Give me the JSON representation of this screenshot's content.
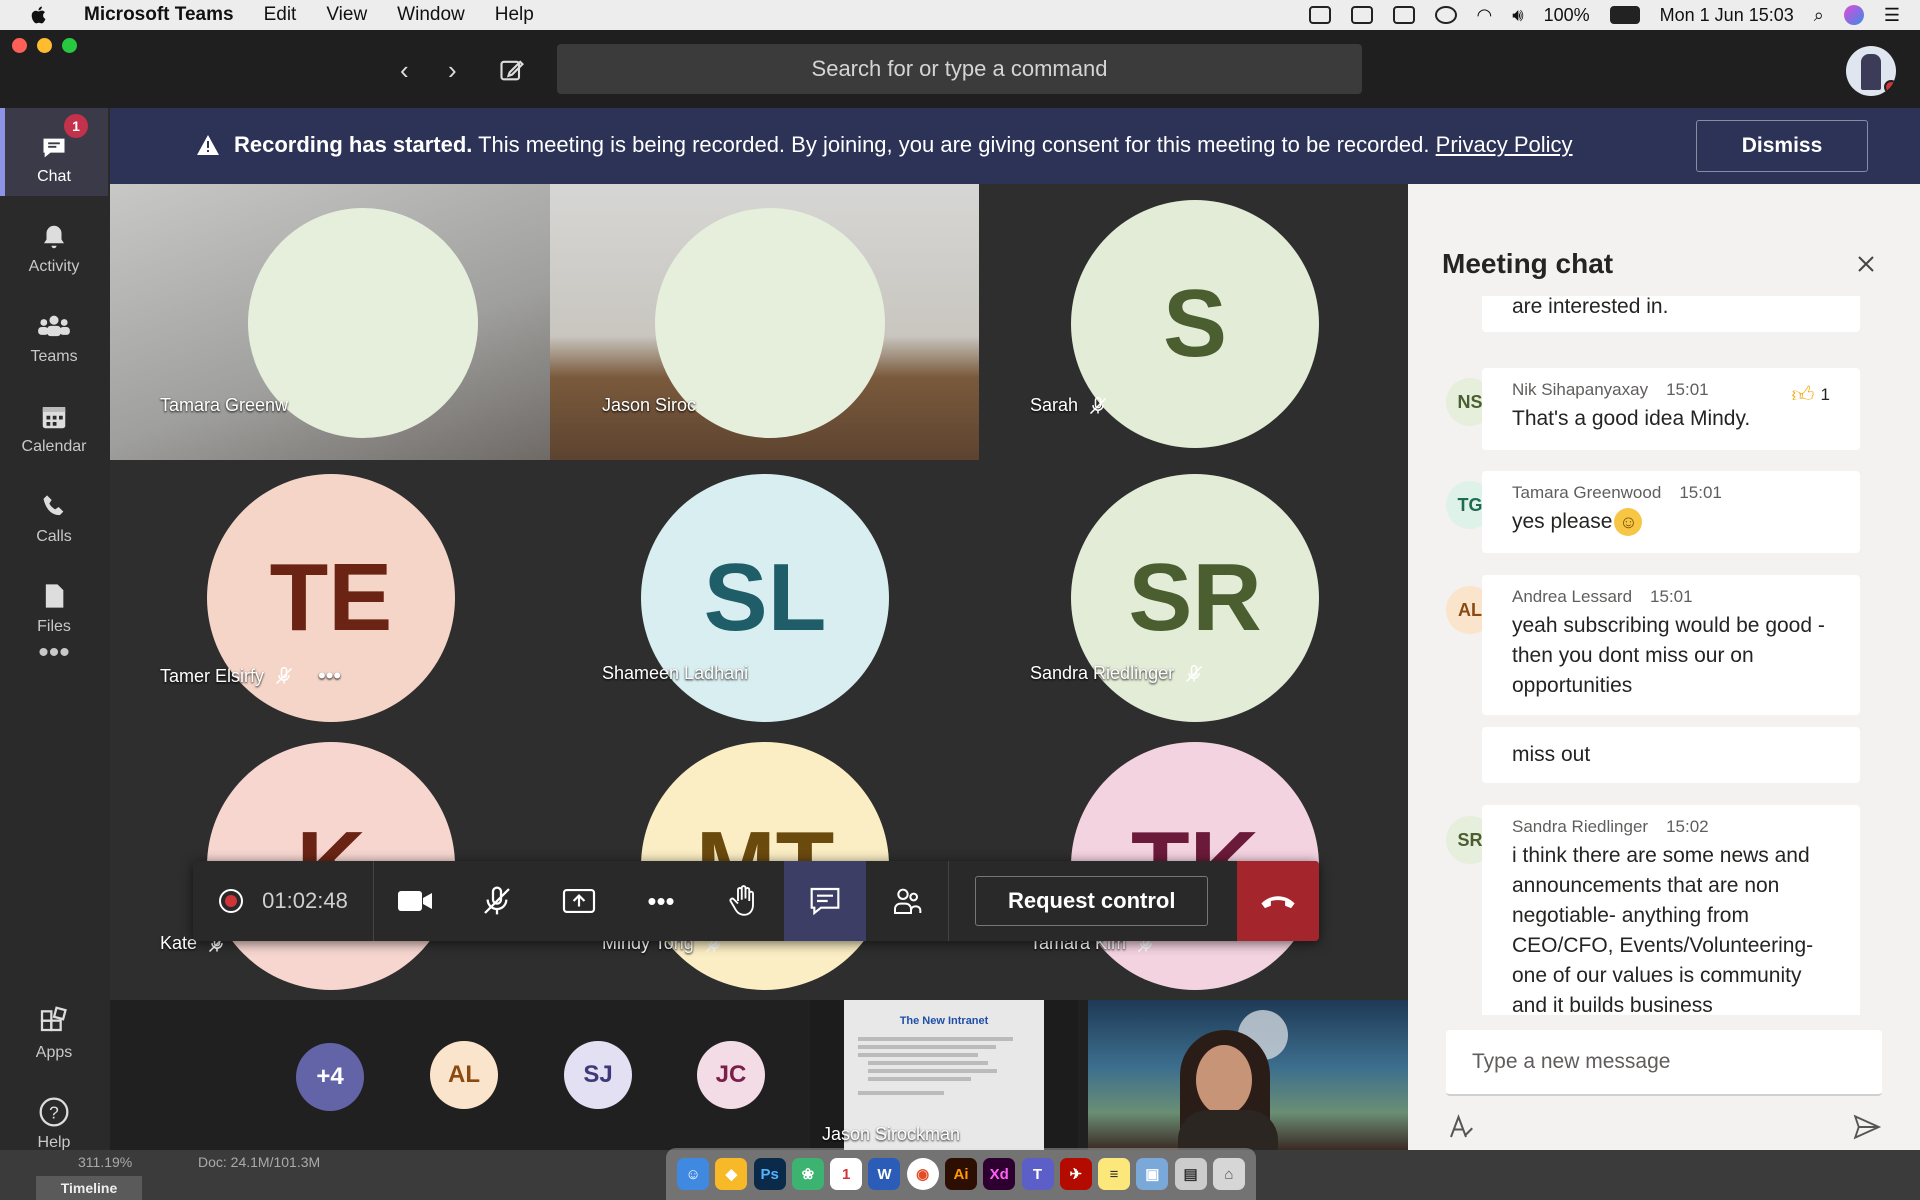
{
  "menubar": {
    "items": [
      "Microsoft Teams",
      "Edit",
      "View",
      "Window",
      "Help"
    ],
    "battery": "100%",
    "datetime": "Mon 1 Jun  15:03"
  },
  "titlebar": {
    "search_placeholder": "Search for or type a command"
  },
  "rail": {
    "items": [
      {
        "label": "Chat",
        "badge": "1",
        "icon": "chat-icon"
      },
      {
        "label": "Activity",
        "icon": "bell-icon"
      },
      {
        "label": "Teams",
        "icon": "teams-icon"
      },
      {
        "label": "Calendar",
        "icon": "calendar-icon"
      },
      {
        "label": "Calls",
        "icon": "phone-icon"
      },
      {
        "label": "Files",
        "icon": "file-icon"
      },
      {
        "label": "Apps",
        "icon": "apps-icon"
      },
      {
        "label": "Help",
        "icon": "help-icon"
      }
    ]
  },
  "banner": {
    "bold": "Recording has started.",
    "text": " This meeting is being recorded. By joining, you are giving consent for this meeting to be recorded. ",
    "link": "Privacy Policy",
    "dismiss": "Dismiss"
  },
  "participants": [
    {
      "name": "Tamara Greenw",
      "initials": "",
      "muted": false
    },
    {
      "name": "Jason Siroc",
      "initials": "",
      "muted": false
    },
    {
      "name": "Sarah",
      "initials": "S",
      "muted": true
    },
    {
      "name": "Tamer Elsirfy",
      "initials": "TE",
      "muted": true
    },
    {
      "name": "Shameen Ladhani",
      "initials": "SL",
      "muted": false
    },
    {
      "name": "Sandra Riedlinger",
      "initials": "SR",
      "muted": true
    },
    {
      "name": "Kate",
      "initials": "K",
      "muted": true
    },
    {
      "name": "Mindy Tong",
      "initials": "MT",
      "muted": true
    },
    {
      "name": "Tamara Kim",
      "initials": "TK",
      "muted": true
    }
  ],
  "overflow": [
    "+4",
    "AL",
    "SJ",
    "JC"
  ],
  "share_tile": {
    "slide_title": "The New Intranet",
    "presenter": "Jason Sirockman"
  },
  "controls": {
    "timer": "01:02:48",
    "request_control": "Request control"
  },
  "chat": {
    "title": "Meeting chat",
    "messages": [
      {
        "initials": "",
        "author": "",
        "time": "",
        "text": "are interested in."
      },
      {
        "initials": "NS",
        "author": "Nik Sihapanyaxay",
        "time": "15:01",
        "text": "That's a good idea Mindy.",
        "reaction_count": "1"
      },
      {
        "initials": "TG",
        "author": "Tamara Greenwood",
        "time": "15:01",
        "text": "yes please"
      },
      {
        "initials": "AL",
        "author": "Andrea Lessard",
        "time": "15:01",
        "text": "yeah subscribing would be good - then you dont miss our on opportunities"
      },
      {
        "initials": "",
        "author": "",
        "time": "",
        "text": "miss out"
      },
      {
        "initials": "SR",
        "author": "Sandra Riedlinger",
        "time": "15:02",
        "text": "i think there are some news and announcements that are non negotiable- anything from CEO/CFO, Events/Volunteering- one of our values is community and it builds business"
      }
    ],
    "compose_placeholder": "Type a new message"
  },
  "dock": {
    "zoom": "311.19%",
    "doc": "Doc: 24.1M/101.3M",
    "timeline": "Timeline"
  }
}
